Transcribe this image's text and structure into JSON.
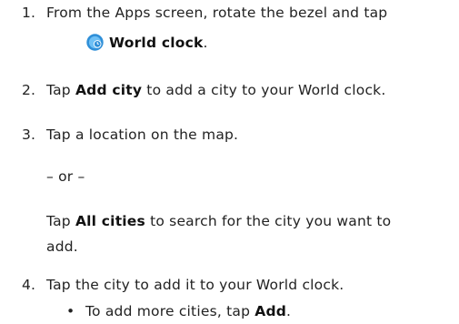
{
  "steps": [
    {
      "number": "1.",
      "line1": "From the Apps screen, rotate the bezel and tap",
      "app_name": "World clock",
      "after": "."
    },
    {
      "number": "2.",
      "pre": "Tap ",
      "bold": "Add city",
      "post": " to add a city to your World clock."
    },
    {
      "number": "3.",
      "text": "Tap a location on the map.",
      "or_text": "– or –",
      "alt_pre": "Tap ",
      "alt_bold": "All cities",
      "alt_post": " to search for the city you want to",
      "alt_line2": "add."
    },
    {
      "number": "4.",
      "text": "Tap the city to add it to your World clock.",
      "bullet_symbol": "•",
      "bullet_pre": "To add more cities, tap ",
      "bullet_bold": "Add",
      "bullet_post": "."
    }
  ],
  "icons": {
    "world_clock": "world-clock-icon"
  },
  "colors": {
    "icon_blue": "#2f8fd8",
    "text": "#222222"
  }
}
